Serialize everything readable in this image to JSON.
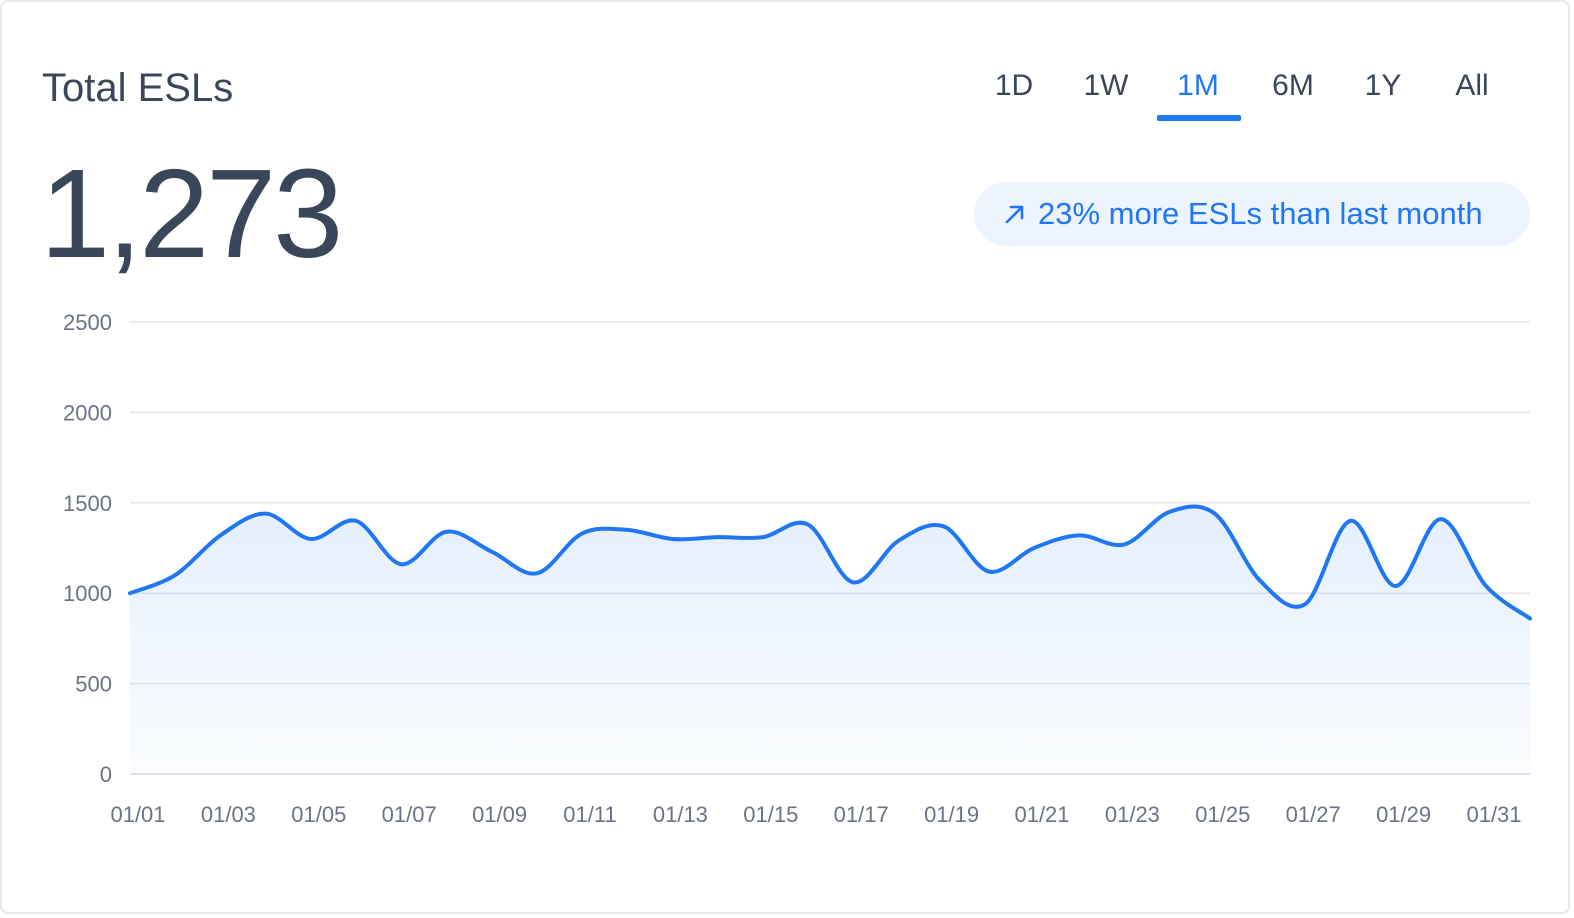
{
  "header": {
    "title": "Total ESLs",
    "value": "1,273",
    "badge_text": "23% more ESLs than last month",
    "badge_icon": "arrow-up-right-icon"
  },
  "tabs": [
    {
      "label": "1D",
      "active": false
    },
    {
      "label": "1W",
      "active": false
    },
    {
      "label": "1M",
      "active": true
    },
    {
      "label": "6M",
      "active": false
    },
    {
      "label": "1Y",
      "active": false
    },
    {
      "label": "All",
      "active": false
    }
  ],
  "colors": {
    "accent": "#1f77f2",
    "text": "#3b4658",
    "axis_text": "#6b7384",
    "grid": "#e3e6eb",
    "badge_bg": "#edf4fe"
  },
  "chart_data": {
    "type": "area",
    "title": "",
    "xlabel": "",
    "ylabel": "",
    "ylim": [
      0,
      2500
    ],
    "yticks": [
      0,
      500,
      1000,
      1500,
      2000,
      2500
    ],
    "xtick_labels": [
      "01/01",
      "01/03",
      "01/05",
      "01/07",
      "01/09",
      "01/11",
      "01/13",
      "01/15",
      "01/17",
      "01/19",
      "01/21",
      "01/23",
      "01/25",
      "01/27",
      "01/29",
      "01/31"
    ],
    "grid": true,
    "legend": "none",
    "series": [
      {
        "x": [
          "01/01",
          "01/02",
          "01/03",
          "01/04",
          "01/05",
          "01/06",
          "01/07",
          "01/08",
          "01/09",
          "01/10",
          "01/11",
          "01/12",
          "01/13",
          "01/14",
          "01/15",
          "01/16",
          "01/17",
          "01/18",
          "01/19",
          "01/20",
          "01/21",
          "01/22",
          "01/23",
          "01/24",
          "01/25",
          "01/26",
          "01/27",
          "01/28",
          "01/29",
          "01/30",
          "01/31",
          "02/01"
        ],
        "values": [
          1000,
          1100,
          1320,
          1440,
          1300,
          1400,
          1160,
          1340,
          1230,
          1110,
          1330,
          1350,
          1300,
          1310,
          1310,
          1380,
          1060,
          1290,
          1370,
          1120,
          1250,
          1320,
          1270,
          1450,
          1440,
          1070,
          940,
          1400,
          1040,
          1410,
          1040,
          860
        ]
      }
    ]
  }
}
